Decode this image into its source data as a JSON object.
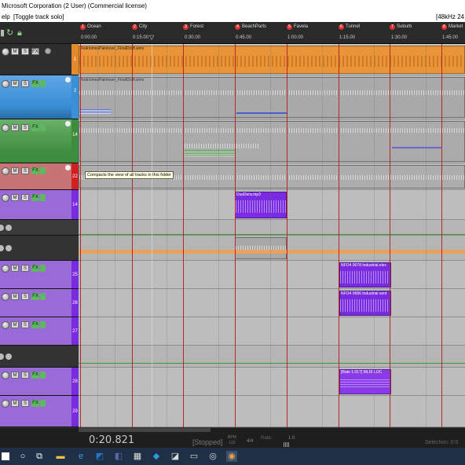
{
  "window": {
    "title": "Microsoft Corporation (2 User) (Commercial license)"
  },
  "menubar": {
    "left": "elp",
    "action": "[Toggle track solo]",
    "right": "[48kHz 24"
  },
  "tcp_buttons": {
    "mute": "M",
    "solo": "S",
    "fx": "FX"
  },
  "tracks": [
    {
      "number": "1",
      "color": "#e58a2c"
    },
    {
      "number": "2",
      "color": "#3a8fd6"
    },
    {
      "number": "14",
      "color": "#3e8c3e"
    },
    {
      "number": "22",
      "color": "#d12020"
    },
    {
      "number": "14",
      "color": "#7a2ae0"
    },
    {
      "number": "25",
      "color": "#7a2ae0"
    },
    {
      "number": "26",
      "color": "#7a2ae0"
    },
    {
      "number": "27",
      "color": "#7a2ae0"
    },
    {
      "number": "28",
      "color": "#7a2ae0"
    },
    {
      "number": "29",
      "color": "#7a2ae0"
    }
  ],
  "markers": [
    {
      "num": "1",
      "label": "Ocean"
    },
    {
      "num": "2",
      "label": "City"
    },
    {
      "num": "3",
      "label": "Forest"
    },
    {
      "num": "4",
      "label": "BeachParts"
    },
    {
      "num": "5",
      "label": "Favela"
    },
    {
      "num": "6",
      "label": "Tunnel"
    },
    {
      "num": "7",
      "label": "Suburb"
    },
    {
      "num": "8",
      "label": "Market"
    }
  ],
  "timeline": [
    "0:00.00",
    "0:15.00",
    "0:30.00",
    "0:45.00",
    "1:00.00",
    "1:15.00",
    "1:30.00",
    "1:45.00"
  ],
  "items": {
    "track1_label": "RodriomesPaintover_FinalDraft.wmv",
    "dusdera": "DusDera.mp3",
    "nfo1": "NFO4 0678 Industrial elec",
    "nfo2": "NFO4 0686 Industrial vent",
    "midi": "[Rate 1.017] MLDI LOC"
  },
  "tooltip": "Compacts the view of all tracks in this folder",
  "transport": {
    "time": "0:20.821",
    "state": "[Stopped]",
    "bpm_label": "BPM",
    "bpm_value": "122",
    "timesig": "4/4",
    "rate_label": "Rate:",
    "rate_value": "1.0",
    "selection": "Selection: 0:0"
  },
  "colors": {
    "orange": "#e58a2c",
    "blue": "#3a8fd6",
    "green": "#3e8c3e",
    "red": "#d12020",
    "purple": "#7a2ae0",
    "marker_line": "#b52828"
  }
}
